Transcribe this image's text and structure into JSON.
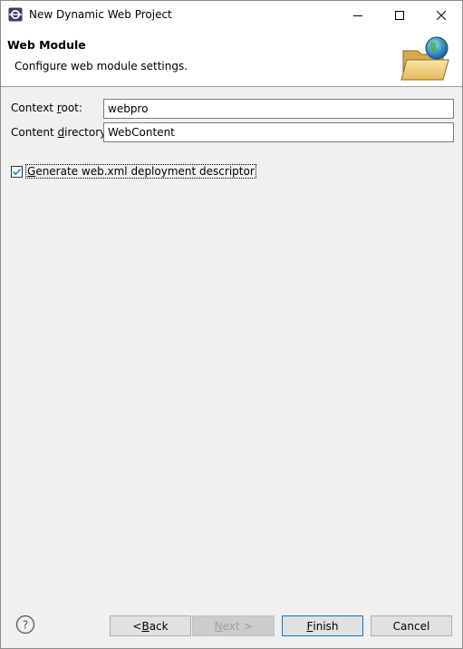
{
  "window": {
    "title": "New Dynamic Web Project",
    "min_glyph": "—",
    "max_glyph": "☐",
    "close_glyph": "✕"
  },
  "banner": {
    "title": "Web Module",
    "description": "Configure web module settings.",
    "icon": "folder-globe-icon"
  },
  "form": {
    "context_root": {
      "label_pre": "Context ",
      "label_mn": "r",
      "label_post": "oot:",
      "value": "webpro"
    },
    "content_directory": {
      "label_pre": "Content ",
      "label_mn": "d",
      "label_post": "irectory:",
      "value": "WebContent"
    },
    "generate_descriptor": {
      "label_mn": "G",
      "label_post": "enerate web.xml deployment descriptor",
      "checked": true
    }
  },
  "buttons": {
    "back": {
      "pre": "< ",
      "mn": "B",
      "post": "ack"
    },
    "next": {
      "pre": "",
      "mn": "N",
      "post": "ext >"
    },
    "finish": {
      "pre": "",
      "mn": "F",
      "post": "inish"
    },
    "cancel": {
      "label": "Cancel"
    }
  },
  "colors": {
    "accent": "#0078d7",
    "check": "#0078d7"
  }
}
